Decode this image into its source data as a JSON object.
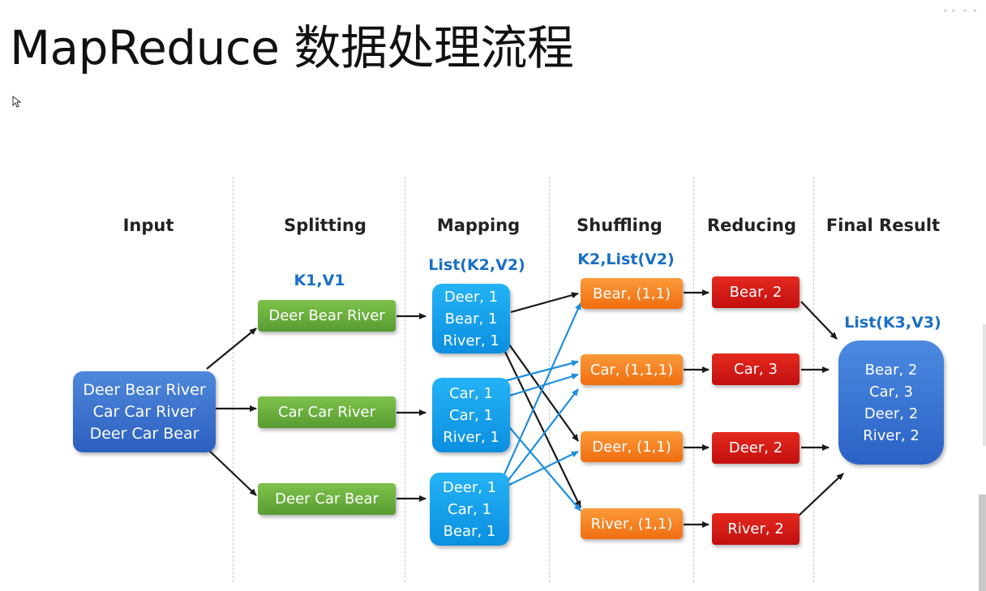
{
  "title": "MapReduce 数据处理流程",
  "stages": [
    "Input",
    "Splitting",
    "Mapping",
    "Shuffling",
    "Reducing",
    "Final Result"
  ],
  "kv_labels": {
    "splitting": "K1,V1",
    "mapping": "List(K2,V2)",
    "shuffling": "K2,List(V2)",
    "final": "List(K3,V3)"
  },
  "input": [
    "Deer Bear River",
    "Car Car River",
    "Deer Car Bear"
  ],
  "splits": [
    "Deer Bear River",
    "Car Car River",
    "Deer Car Bear"
  ],
  "mappings": [
    [
      "Deer, 1",
      "Bear, 1",
      "River, 1"
    ],
    [
      "Car, 1",
      "Car, 1",
      "River, 1"
    ],
    [
      "Deer, 1",
      "Car, 1",
      "Bear, 1"
    ]
  ],
  "shuffles": [
    "Bear, (1,1)",
    "Car, (1,1,1)",
    "Deer, (1,1)",
    "River, (1,1)"
  ],
  "reduces": [
    "Bear, 2",
    "Car, 3",
    "Deer, 2",
    "River, 2"
  ],
  "final": [
    "Bear, 2",
    "Car, 3",
    "Deer, 2",
    "River, 2"
  ],
  "colors": {
    "input": "#3a70cf",
    "split": "#6aaf3d",
    "map": "#16a0ea",
    "shuffle": "#f5801f",
    "reduce": "#d41a16",
    "final": "#3a74d4",
    "kv_text": "#1a6fc5",
    "black_arrow": "#1a1a1a",
    "blue_arrow": "#1e8fe0"
  }
}
